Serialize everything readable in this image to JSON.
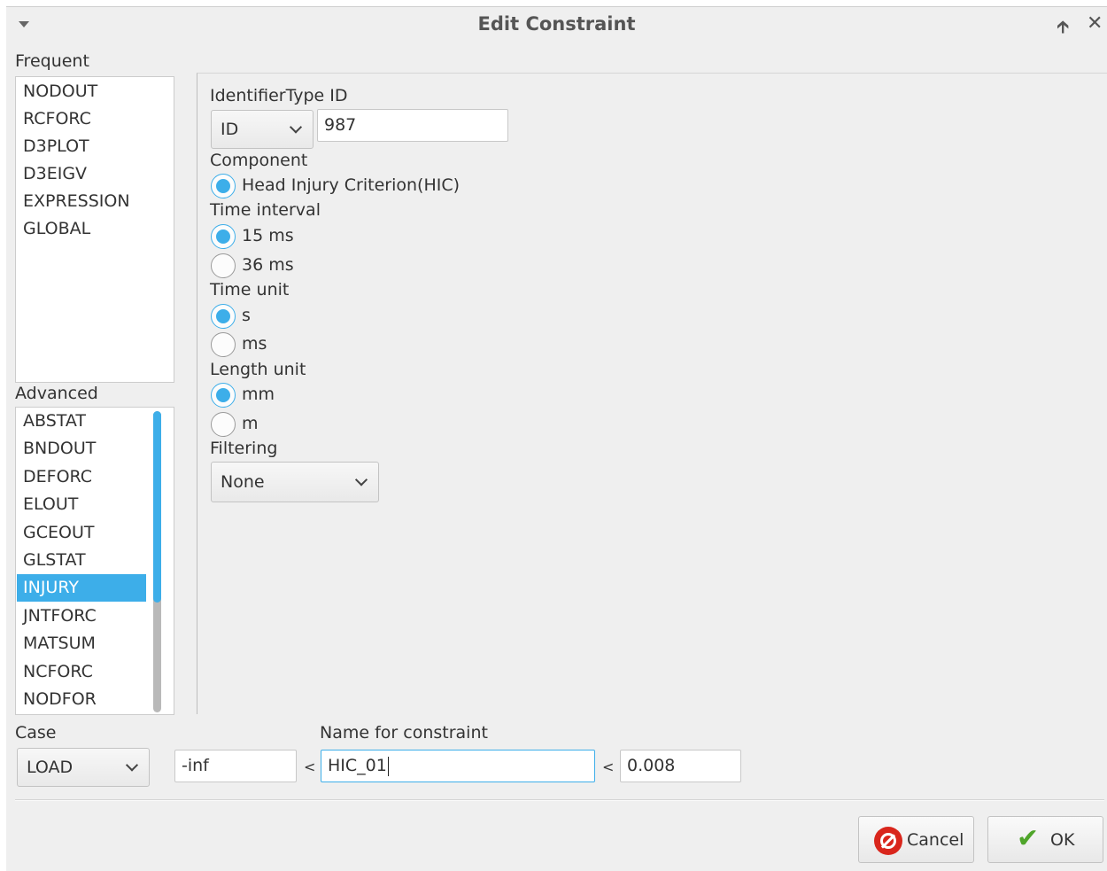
{
  "window": {
    "title": "Edit Constraint"
  },
  "frequent": {
    "label": "Frequent",
    "items": [
      "NODOUT",
      "RCFORC",
      "D3PLOT",
      "D3EIGV",
      "EXPRESSION",
      "GLOBAL"
    ]
  },
  "advanced": {
    "label": "Advanced",
    "items": [
      "ABSTAT",
      "BNDOUT",
      "DEFORC",
      "ELOUT",
      "GCEOUT",
      "GLSTAT",
      "INJURY",
      "JNTFORC",
      "MATSUM",
      "NCFORC",
      "NODFOR"
    ],
    "selected": "INJURY"
  },
  "identifier": {
    "type_label": "IdentifierType",
    "id_label": "ID",
    "type_value": "ID",
    "id_value": "987"
  },
  "component": {
    "label": "Component",
    "options": [
      "Head Injury Criterion(HIC)"
    ],
    "selected": "Head Injury Criterion(HIC)"
  },
  "time_interval": {
    "label": "Time interval",
    "options": [
      "15 ms",
      "36 ms"
    ],
    "selected": "15 ms"
  },
  "time_unit": {
    "label": "Time unit",
    "options": [
      "s",
      "ms"
    ],
    "selected": "s"
  },
  "length_unit": {
    "label": "Length unit",
    "options": [
      "mm",
      "m"
    ],
    "selected": "mm"
  },
  "filtering": {
    "label": "Filtering",
    "value": "None"
  },
  "case": {
    "label": "Case",
    "value": "LOAD"
  },
  "constraint": {
    "name_label": "Name for constraint",
    "lower": "-inf",
    "lt1": "<",
    "name": "HIC_01",
    "lt2": "<",
    "upper": "0.008"
  },
  "buttons": {
    "cancel": "Cancel",
    "ok": "OK"
  },
  "icons": {
    "menu": "chevron-down-icon",
    "pin": "pin-up-arrow-icon",
    "close": "close-icon",
    "cancel": "cancel-icon",
    "ok": "checkmark-icon"
  },
  "colors": {
    "accent": "#3daee9",
    "cancel_icon": "#d9261c",
    "ok_icon": "#4fa52a"
  }
}
